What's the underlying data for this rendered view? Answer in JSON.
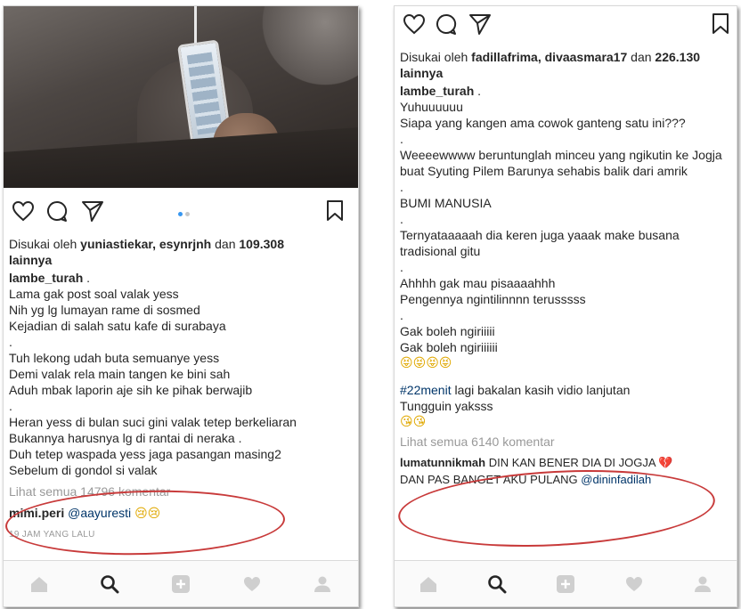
{
  "left_post": {
    "likes_prefix": "Disukai oleh ",
    "likes_names": "yuniastiekar, esynrjnh",
    "likes_and": " dan ",
    "likes_count": "109.308",
    "likes_suffix": "lainnya",
    "username": "lambe_turah",
    "username_dot": " .",
    "caption": [
      "Lama gak post soal valak yess",
      "Nih yg lg lumayan rame di sosmed",
      "Kejadian di salah satu kafe di surabaya",
      ".",
      "Tuh lekong udah buta semuanye yess",
      "Demi valak rela main tangen ke bini sah",
      "Aduh mbak laporin aje sih ke pihak berwajib",
      ".",
      "Heran yess di bulan suci gini valak tetep berkeliaran",
      "Bukannya harusnya lg di rantai di neraka .",
      "Duh tetep waspada yess jaga pasangan masing2",
      "Sebelum di gondol si valak"
    ],
    "view_all": "Lihat semua 14796 komentar",
    "comment_user": "mimi.peri",
    "comment_mention": "@aayuresti",
    "comment_emoji": "😢😢",
    "timestamp": "19 JAM YANG LALU"
  },
  "right_post": {
    "likes_prefix": "Disukai oleh ",
    "likes_names": "fadillafrima, divaasmara17",
    "likes_and": " dan ",
    "likes_count": "226.130",
    "likes_suffix": "lainnya",
    "username": "lambe_turah",
    "username_dot": " .",
    "caption": [
      "Yuhuuuuuu",
      "Siapa yang kangen ama cowok ganteng satu ini???",
      ".",
      "Weeeewwww beruntunglah minceu yang ngikutin ke Jogja buat Syuting Pilem Barunya sehabis balik dari amrik",
      ".",
      "BUMI MANUSIA",
      ".",
      "Ternyataaaaah dia keren juga yaaak make busana tradisional gitu",
      ".",
      "Ahhhh gak mau pisaaaahhh",
      "Pengennya ngintilinnnn terusssss",
      ".",
      "Gak boleh ngiriiiii",
      "Gak boleh ngiriiiiii",
      "😝😝😝😝"
    ],
    "hashtag": "#22menit",
    "hashtag_rest": " lagi bakalan kasih vidio lanjutan",
    "tail_line": "Tungguin yaksss",
    "tail_emoji": "😘😘",
    "view_all": "Lihat semua 6140 komentar",
    "comment_user": "lumatunnikmah",
    "comment_text": " DIN KAN BENER DIA DI JOGJA ",
    "comment_emoji": "💔",
    "comment_text2": "DAN PAS BANGET AKU PULANG ",
    "comment_mention": "@dininfadilah"
  },
  "icons": {
    "like": "heart-outline-icon",
    "comment": "comment-bubble-icon",
    "share": "paper-plane-icon",
    "save": "bookmark-icon",
    "nav": [
      "home-icon",
      "search-icon",
      "add-post-icon",
      "activity-heart-icon",
      "profile-icon"
    ]
  },
  "colors": {
    "annotation": "#c83a3a",
    "dot_active": "#3897f0",
    "link": "#003569",
    "muted": "#999999"
  }
}
